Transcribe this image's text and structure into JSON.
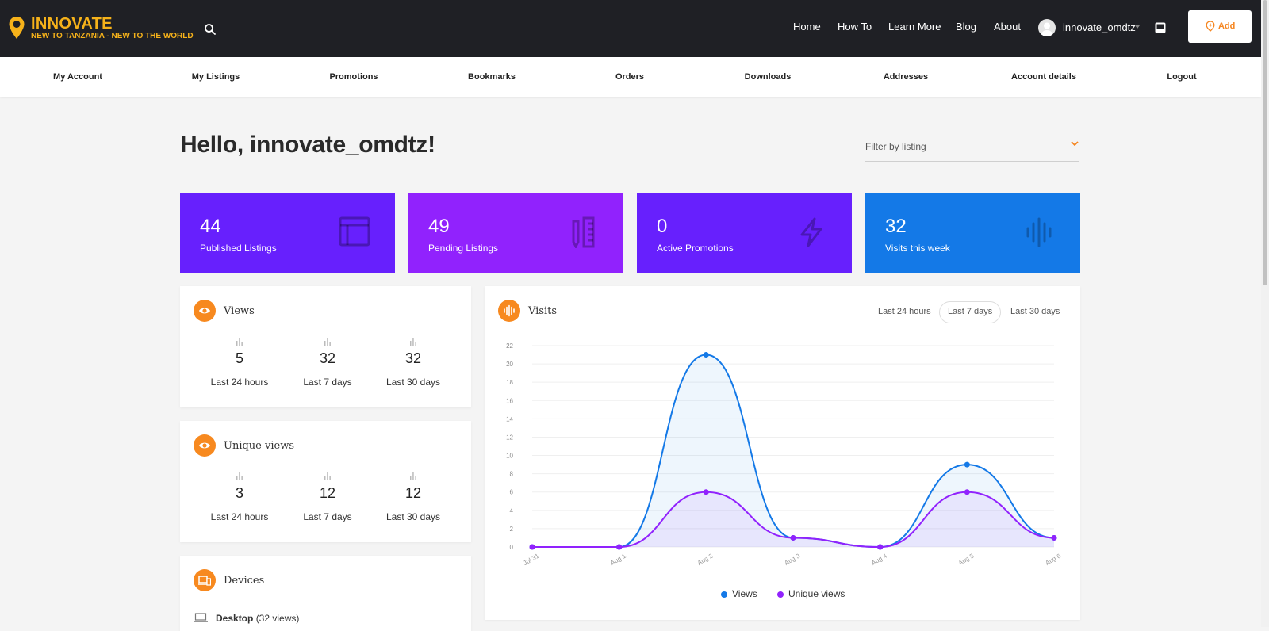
{
  "header": {
    "brand": "INNOVATE",
    "tagline": "NEW TO TANZANIA - NEW TO THE WORLD",
    "nav": [
      "Home",
      "How To",
      "Learn More",
      "Blog",
      "About"
    ],
    "username": "innovate_omdtz",
    "add_label": "Add"
  },
  "subnav": [
    "My Account",
    "My Listings",
    "Promotions",
    "Bookmarks",
    "Orders",
    "Downloads",
    "Addresses",
    "Account details",
    "Logout"
  ],
  "greeting": "Hello, innovate_omdtz!",
  "filter": {
    "label": "Filter by listing"
  },
  "stats": [
    {
      "value": "44",
      "label": "Published Listings",
      "color": "#6720fd",
      "icon": "browser-window-icon"
    },
    {
      "value": "49",
      "label": "Pending Listings",
      "color": "#9122fd",
      "icon": "pencil-ruler-icon"
    },
    {
      "value": "0",
      "label": "Active Promotions",
      "color": "#6720fd",
      "icon": "lightning-icon"
    },
    {
      "value": "32",
      "label": "Visits this week",
      "color": "#1479e7",
      "icon": "audio-wave-icon"
    }
  ],
  "views": {
    "title": "Views",
    "metrics": [
      {
        "value": "5",
        "label": "Last 24 hours"
      },
      {
        "value": "32",
        "label": "Last 7 days"
      },
      {
        "value": "32",
        "label": "Last 30 days"
      }
    ]
  },
  "unique_views": {
    "title": "Unique views",
    "metrics": [
      {
        "value": "3",
        "label": "Last 24 hours"
      },
      {
        "value": "12",
        "label": "Last 7 days"
      },
      {
        "value": "12",
        "label": "Last 30 days"
      }
    ]
  },
  "devices": {
    "title": "Devices",
    "items": [
      {
        "name": "Desktop",
        "count": "(32 views)"
      }
    ]
  },
  "visits": {
    "title": "Visits",
    "ranges": [
      "Last 24 hours",
      "Last 7 days",
      "Last 30 days"
    ],
    "active_range": "Last 7 days"
  },
  "accent": "#f7891f",
  "chart_data": {
    "type": "line",
    "x": [
      "Jul 31",
      "Aug 1",
      "Aug 2",
      "Aug 3",
      "Aug 4",
      "Aug 5",
      "Aug 6"
    ],
    "series": [
      {
        "name": "Views",
        "values": [
          0,
          0,
          21,
          1,
          0,
          9,
          1
        ],
        "color": "#1479e7"
      },
      {
        "name": "Unique views",
        "values": [
          0,
          0,
          6,
          1,
          0,
          6,
          1
        ],
        "color": "#9122fd"
      }
    ],
    "yticks": [
      0,
      2,
      4,
      6,
      8,
      10,
      12,
      14,
      16,
      18,
      20,
      22
    ],
    "ylim": [
      0,
      22
    ],
    "grid": true,
    "legend": "bottom"
  }
}
